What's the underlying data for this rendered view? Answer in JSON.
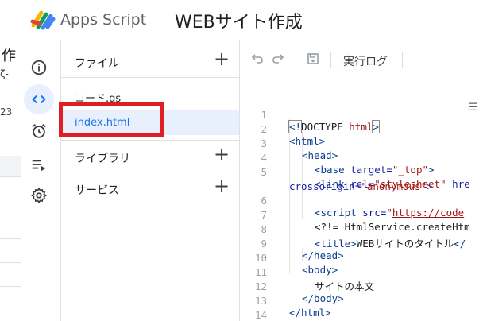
{
  "header": {
    "app_name": "Apps Script",
    "project_title": "WEBサイト作成"
  },
  "background_fragment": {
    "text_1": "作",
    "text_2": "ζ-",
    "text_3": "23"
  },
  "rail": {
    "items": [
      {
        "name": "overview",
        "icon": "info-icon"
      },
      {
        "name": "editor",
        "icon": "code-icon",
        "active": true
      },
      {
        "name": "triggers",
        "icon": "alarm-icon"
      },
      {
        "name": "executions",
        "icon": "list-play-icon"
      },
      {
        "name": "settings",
        "icon": "gear-icon"
      }
    ]
  },
  "files_panel": {
    "files_label": "ファイル",
    "files": [
      {
        "label": "コード.gs",
        "selected": false
      },
      {
        "label": "index.html",
        "selected": true
      }
    ],
    "libraries_label": "ライブラリ",
    "services_label": "サービス"
  },
  "toolbar": {
    "undo_icon": "undo-icon",
    "redo_icon": "redo-icon",
    "save_icon": "save-icon",
    "log_label": "実行ログ"
  },
  "code": {
    "line_numbers": [
      "1",
      "2",
      "3",
      "4",
      "5",
      "6",
      "7",
      "8",
      "9",
      "10",
      "11",
      "12",
      "13",
      "14"
    ],
    "l1_open": "<!",
    "l1_doctype": "DOCTYPE",
    "l1_html": " html",
    "l1_close": ">",
    "l2": "<html>",
    "l3": "<head>",
    "l4_tag": "<base",
    "l4_attr": " target=",
    "l4_val": "\"_top\"",
    "l4_end": ">",
    "l5_tag": "<link",
    "l5_attr": " rel=",
    "l5_val": "\"stylesheet\"",
    "l5_rest": " hre",
    "l5_wrap_attr": "crossorigin=",
    "l5_wrap_val": "\"anonymous\"",
    "l5_wrap_end": ">",
    "l6_tag": "<script",
    "l6_attr": " src=",
    "l6_q": "\"",
    "l6_link": "https://code",
    "l7": "<?!= HtmlService.createHtm",
    "l8_tag": "<title>",
    "l8_text": "WEBサイトのタイトル",
    "l8_end": "</",
    "l9": "</head>",
    "l10": "<body>",
    "l11": "サイトの本文",
    "l12": "</body>",
    "l13": "</html>"
  }
}
